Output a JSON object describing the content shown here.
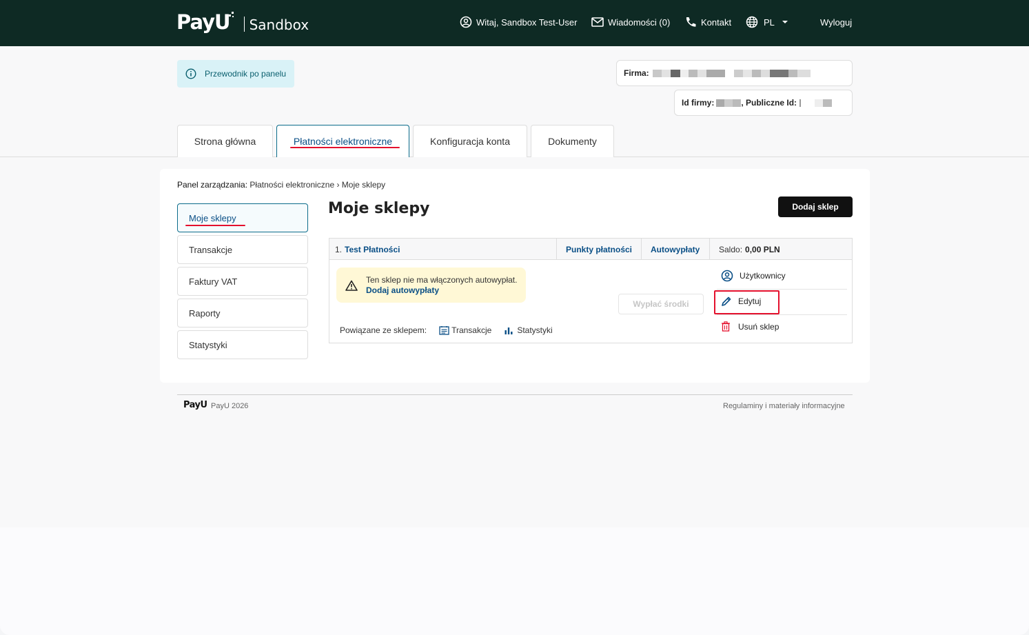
{
  "header": {
    "logo_text": "PayU",
    "sandbox_label": "Sandbox",
    "greeting": "Witaj, Sandbox Test-User",
    "messages": "Wiadomości (0)",
    "contact": "Kontakt",
    "language": "PL",
    "logout": "Wyloguj"
  },
  "guide": {
    "label": "Przewodnik po panelu"
  },
  "company": {
    "firma_label": "Firma:",
    "id_label": "Id firmy:",
    "public_id_label": ", Publiczne Id:"
  },
  "tabs": [
    {
      "label": "Strona główna"
    },
    {
      "label": "Płatności elektroniczne"
    },
    {
      "label": "Konfiguracja konta"
    },
    {
      "label": "Dokumenty"
    }
  ],
  "breadcrumb": {
    "lead": "Panel zarządzania:",
    "path": " Płatności elektroniczne › Moje sklepy"
  },
  "sidebar": {
    "items": [
      {
        "label": "Moje sklepy"
      },
      {
        "label": "Transakcje"
      },
      {
        "label": "Faktury VAT"
      },
      {
        "label": "Raporty"
      },
      {
        "label": "Statystyki"
      }
    ]
  },
  "main": {
    "title": "Moje sklepy",
    "add_shop": "Dodaj sklep"
  },
  "shop": {
    "index": "1.",
    "name": "Test Płatności",
    "points": "Punkty płatności",
    "autopayouts": "Autowypłaty",
    "balance_label": "Saldo:",
    "balance_value": "0,00 PLN",
    "warning_text": "Ten sklep nie ma włączonych autowypłat.",
    "warning_link": "Dodaj autowypłaty",
    "withdraw": "Wypłać środki",
    "related_label": "Powiązane ze sklepem:",
    "related_transactions": "Transakcje",
    "related_stats": "Statystyki",
    "actions": {
      "users": "Użytkownicy",
      "edit": "Edytuj",
      "delete": "Usuń sklep"
    }
  },
  "footer": {
    "logo": "PayU",
    "copyright": "PayU 2026",
    "terms": "Regulaminy i materiały informacyjne"
  },
  "colors": {
    "topbar": "#0e2a24",
    "accent_link": "#0a4f86",
    "highlight": "#e4102d",
    "guide_bg": "#d9f2f7",
    "warning_bg": "#fff8d6"
  }
}
